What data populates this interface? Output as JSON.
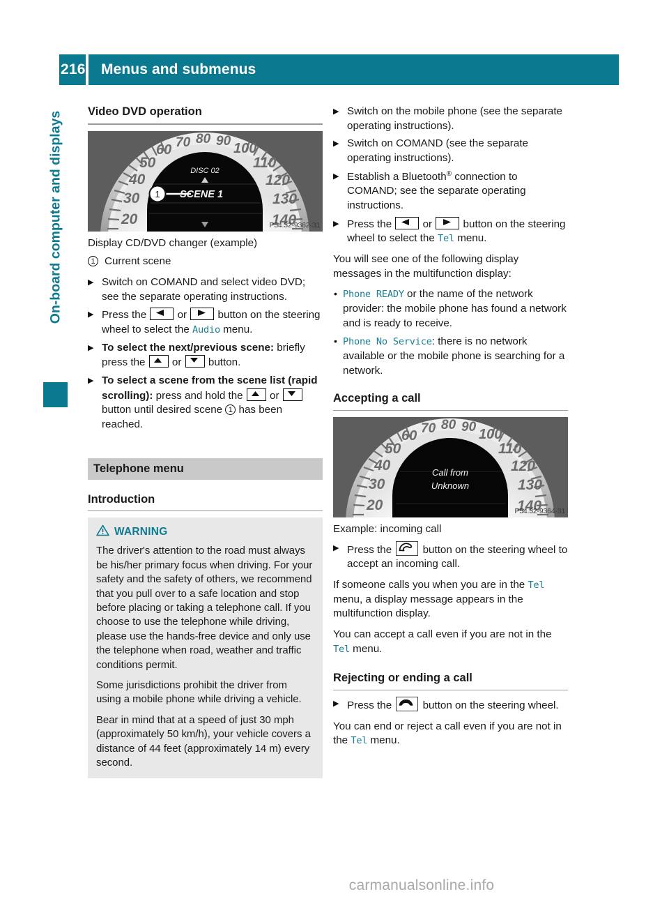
{
  "header": {
    "page_number": "216",
    "title": "Menus and submenus"
  },
  "sidebar": {
    "chapter_label": "On-board computer and displays"
  },
  "footer": {
    "watermark": "carmanualsonline.info"
  },
  "left_column": {
    "section_title": "Video DVD operation",
    "figure": {
      "alt_name": "instrument-cluster-dvd",
      "display_disc": "DISC 02",
      "display_scene": "SCENE 1",
      "marker": "1",
      "image_code": "P54.32-9362-31",
      "speed_ticks": [
        "20",
        "30",
        "40",
        "50",
        "60",
        "70",
        "80",
        "90",
        "100",
        "110",
        "120",
        "130",
        "140"
      ]
    },
    "figure_caption": "Display CD/DVD changer (example)",
    "legend": {
      "marker": "1",
      "text": "Current scene"
    },
    "steps": [
      {
        "parts": [
          {
            "type": "text",
            "value": "Switch on COMAND and select video DVD; see the separate operating instructions."
          }
        ]
      },
      {
        "parts": [
          {
            "type": "text",
            "value": "Press the "
          },
          {
            "type": "key",
            "value": "left-arrow-key"
          },
          {
            "type": "text",
            "value": " or "
          },
          {
            "type": "key",
            "value": "right-arrow-key"
          },
          {
            "type": "text",
            "value": " button on the steering wheel to select the "
          },
          {
            "type": "mono",
            "value": "Audio"
          },
          {
            "type": "text",
            "value": " menu."
          }
        ]
      },
      {
        "parts": [
          {
            "type": "bold",
            "value": "To select the next/previous scene:"
          },
          {
            "type": "text",
            "value": " briefly press the "
          },
          {
            "type": "key",
            "value": "up-arrow-key"
          },
          {
            "type": "text",
            "value": " or "
          },
          {
            "type": "key",
            "value": "down-arrow-key"
          },
          {
            "type": "text",
            "value": " button."
          }
        ]
      },
      {
        "parts": [
          {
            "type": "bold",
            "value": "To select a scene from the scene list (rapid scrolling):"
          },
          {
            "type": "text",
            "value": " press and hold the "
          },
          {
            "type": "key",
            "value": "up-arrow-key"
          },
          {
            "type": "text",
            "value": " or "
          },
          {
            "type": "key",
            "value": "down-arrow-key"
          },
          {
            "type": "text",
            "value": " button until desired scene "
          },
          {
            "type": "numref",
            "value": "1"
          },
          {
            "type": "text",
            "value": " has been reached."
          }
        ]
      }
    ],
    "telephone_band": "Telephone menu",
    "introduction_title": "Introduction",
    "warning": {
      "icon": "warning-triangle-icon",
      "label": "WARNING",
      "paragraphs": [
        "The driver's attention to the road must always be his/her primary focus when driving. For your safety and the safety of others, we recommend that you pull over to a safe location and stop before placing or taking a telephone call. If you choose to use the telephone while driving, please use the hands-free device and only use the telephone when road, weather and traffic conditions permit.",
        "Some jurisdictions prohibit the driver from using a mobile phone while driving a vehicle.",
        "Bear in mind that at a speed of just 30 mph (approximately 50 km/h), your vehicle covers a distance of 44 feet (approximately 14 m) every second."
      ]
    }
  },
  "right_column": {
    "steps": [
      {
        "parts": [
          {
            "type": "text",
            "value": "Switch on the mobile phone (see the separate operating instructions)."
          }
        ]
      },
      {
        "parts": [
          {
            "type": "text",
            "value": "Switch on COMAND (see the separate operating instructions)."
          }
        ]
      },
      {
        "parts": [
          {
            "type": "text",
            "value": "Establish a Bluetooth"
          },
          {
            "type": "sup",
            "value": "®"
          },
          {
            "type": "text",
            "value": " connection to COMAND; see the separate operating instructions."
          }
        ]
      },
      {
        "parts": [
          {
            "type": "text",
            "value": "Press the "
          },
          {
            "type": "key",
            "value": "left-arrow-key"
          },
          {
            "type": "text",
            "value": " or "
          },
          {
            "type": "key",
            "value": "right-arrow-key"
          },
          {
            "type": "text",
            "value": " button on the steering wheel to select the "
          },
          {
            "type": "mono",
            "value": "Tel"
          },
          {
            "type": "text",
            "value": " menu."
          }
        ]
      }
    ],
    "intro_paragraph": "You will see one of the following display messages in the multifunction display:",
    "messages": [
      {
        "code": "Phone READY",
        "text": " or the name of the network provider: the mobile phone has found a network and is ready to receive."
      },
      {
        "code": "Phone No Service",
        "text": ": there is no network available or the mobile phone is searching for a network."
      }
    ],
    "accepting_title": "Accepting a call",
    "figure": {
      "alt_name": "instrument-cluster-incoming-call",
      "display_line1": "Call from",
      "display_line2": "Unknown",
      "image_code": "P54.32-9364-31",
      "speed_ticks": [
        "20",
        "30",
        "40",
        "50",
        "60",
        "70",
        "80",
        "90",
        "100",
        "110",
        "120",
        "130",
        "140"
      ]
    },
    "figure_caption": "Example: incoming call",
    "accept_step": {
      "before": "Press the ",
      "key": "phone-pickup-icon",
      "after": " button on the steering wheel to accept an incoming call."
    },
    "accepting_paragraph_1_a": "If someone calls you when you are in the ",
    "accepting_paragraph_1_code": "Tel",
    "accepting_paragraph_1_b": " menu, a display message appears in the multifunction display.",
    "accepting_paragraph_2_a": "You can accept a call even if you are not in the ",
    "accepting_paragraph_2_code": "Tel",
    "accepting_paragraph_2_b": " menu.",
    "rejecting_title": "Rejecting or ending a call",
    "reject_step": {
      "before": "Press the ",
      "key": "phone-hangup-icon",
      "after": " button on the steering wheel."
    },
    "rejecting_paragraph_a": "You can end or reject a call even if you are not in the ",
    "rejecting_paragraph_code": "Tel",
    "rejecting_paragraph_b": " menu."
  },
  "colors": {
    "accent_teal": "#0b7a90",
    "mono_teal": "#1a7f94",
    "band_gray": "#c9c9c9",
    "warning_bg": "#e8e8e8"
  }
}
